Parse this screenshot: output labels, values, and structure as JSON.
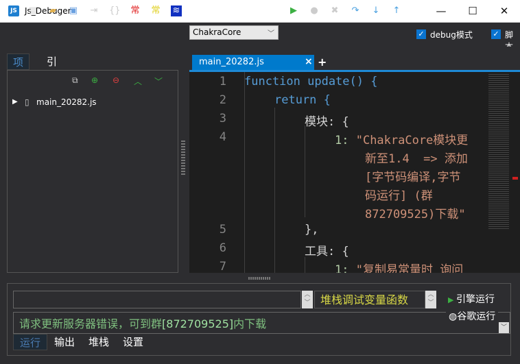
{
  "window": {
    "title": "Js_Debuger",
    "app_icon": "JS"
  },
  "toolbar": {
    "icon_chang1": "常",
    "icon_chang2": "常",
    "engine": "ChakraCore",
    "debug_label": "debug模式",
    "script_label": "脚本"
  },
  "left": {
    "tabs": [
      {
        "label": "项目"
      },
      {
        "label": "引库"
      }
    ],
    "tree": [
      {
        "label": "main_20282.js"
      }
    ]
  },
  "editor": {
    "tab": "main_20282.js",
    "close": "×",
    "add": "+",
    "lines": [
      {
        "n": "1",
        "text": "function update() {"
      },
      {
        "n": "2",
        "text": "return {"
      },
      {
        "n": "3",
        "text": "模块: {"
      },
      {
        "n": "4",
        "key": "1: ",
        "text": "\"ChakraCore模块更"
      },
      {
        "n": "",
        "text": "新至1.4  => 添加"
      },
      {
        "n": "",
        "text": "[字节码编译,字节"
      },
      {
        "n": "",
        "text": "码运行] (群"
      },
      {
        "n": "",
        "text": "872709525)下载\""
      },
      {
        "n": "5",
        "text": "},"
      },
      {
        "n": "6",
        "text": "工具: {"
      },
      {
        "n": "7",
        "key": "1: ",
        "text": "\"复制易常量时 询问"
      }
    ]
  },
  "bottom": {
    "stack_label": "堆栈调试变量函数",
    "engine_run": "引擎运行",
    "chrome_run": "谷歌运行",
    "output_pre": "请求更新服务器错误，可到群",
    "output_num": "[872709525]",
    "output_post": "内下载",
    "tabs": [
      {
        "label": "运行"
      },
      {
        "label": "输出"
      },
      {
        "label": "堆栈"
      },
      {
        "label": "设置"
      }
    ]
  },
  "colors": {
    "accent": "#007acc",
    "keyword": "#569cd6",
    "string": "#ce9178"
  }
}
